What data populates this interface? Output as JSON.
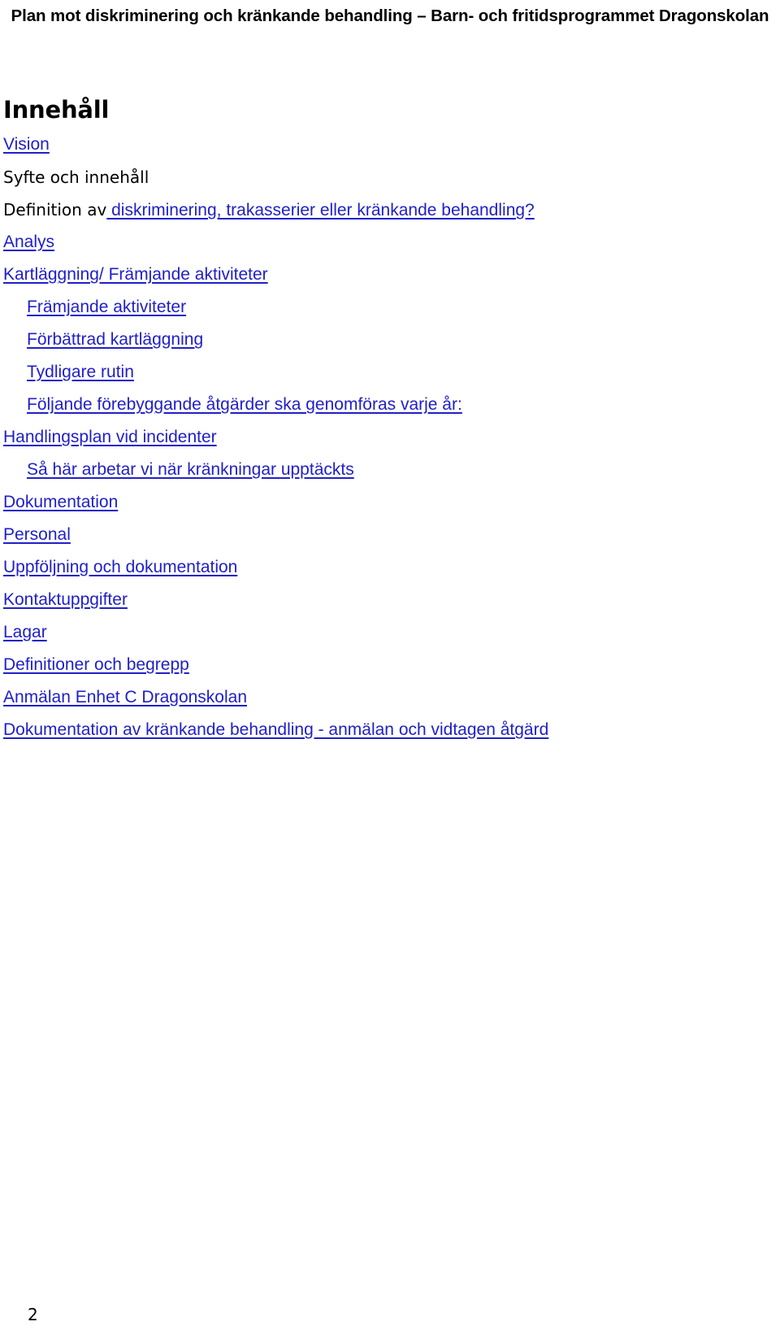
{
  "document": {
    "running_header": "Plan mot diskriminering och kränkande behandling – Barn- och fritidsprogrammet Dragonskolan",
    "page_number": "2",
    "link_color": "#2020c8",
    "text_color": "#000000",
    "background_color": "#ffffff"
  },
  "toc": {
    "heading": "Innehåll",
    "entries": [
      {
        "label": "Vision",
        "level": 0,
        "style": "link"
      },
      {
        "label": "Syfte och innehåll",
        "level": 0,
        "style": "plain"
      },
      {
        "label": "Definition av",
        "tail": " diskriminering, trakasserier eller kränkande behandling?",
        "level": 0,
        "style": "mixed"
      },
      {
        "label": "Analys",
        "level": 0,
        "style": "link"
      },
      {
        "label": "Kartläggning/ Främjande aktiviteter",
        "level": 0,
        "style": "link"
      },
      {
        "label": "Främjande aktiviteter",
        "level": 1,
        "style": "link"
      },
      {
        "label": "Förbättrad kartläggning",
        "level": 1,
        "style": "link"
      },
      {
        "label": "Tydligare rutin",
        "level": 1,
        "style": "link"
      },
      {
        "label": "Följande förebyggande åtgärder ska genomföras varje år:",
        "level": 1,
        "style": "link"
      },
      {
        "label": "Handlingsplan vid incidenter",
        "level": 0,
        "style": "link"
      },
      {
        "label": "Så här arbetar vi när kränkningar upptäckts",
        "level": 1,
        "style": "link"
      },
      {
        "label": "Dokumentation",
        "level": 0,
        "style": "link"
      },
      {
        "label": "Personal",
        "level": 0,
        "style": "link"
      },
      {
        "label": "Uppföljning och dokumentation",
        "level": 0,
        "style": "link"
      },
      {
        "label": "Kontaktuppgifter",
        "level": 0,
        "style": "link"
      },
      {
        "label": "Lagar",
        "level": 0,
        "style": "link"
      },
      {
        "label": "Definitioner och begrepp",
        "level": 0,
        "style": "link"
      },
      {
        "label": "Anmälan Enhet C Dragonskolan",
        "level": 0,
        "style": "link"
      },
      {
        "label": "Dokumentation av kränkande behandling - anmälan och vidtagen åtgärd",
        "level": 0,
        "style": "link"
      }
    ]
  }
}
